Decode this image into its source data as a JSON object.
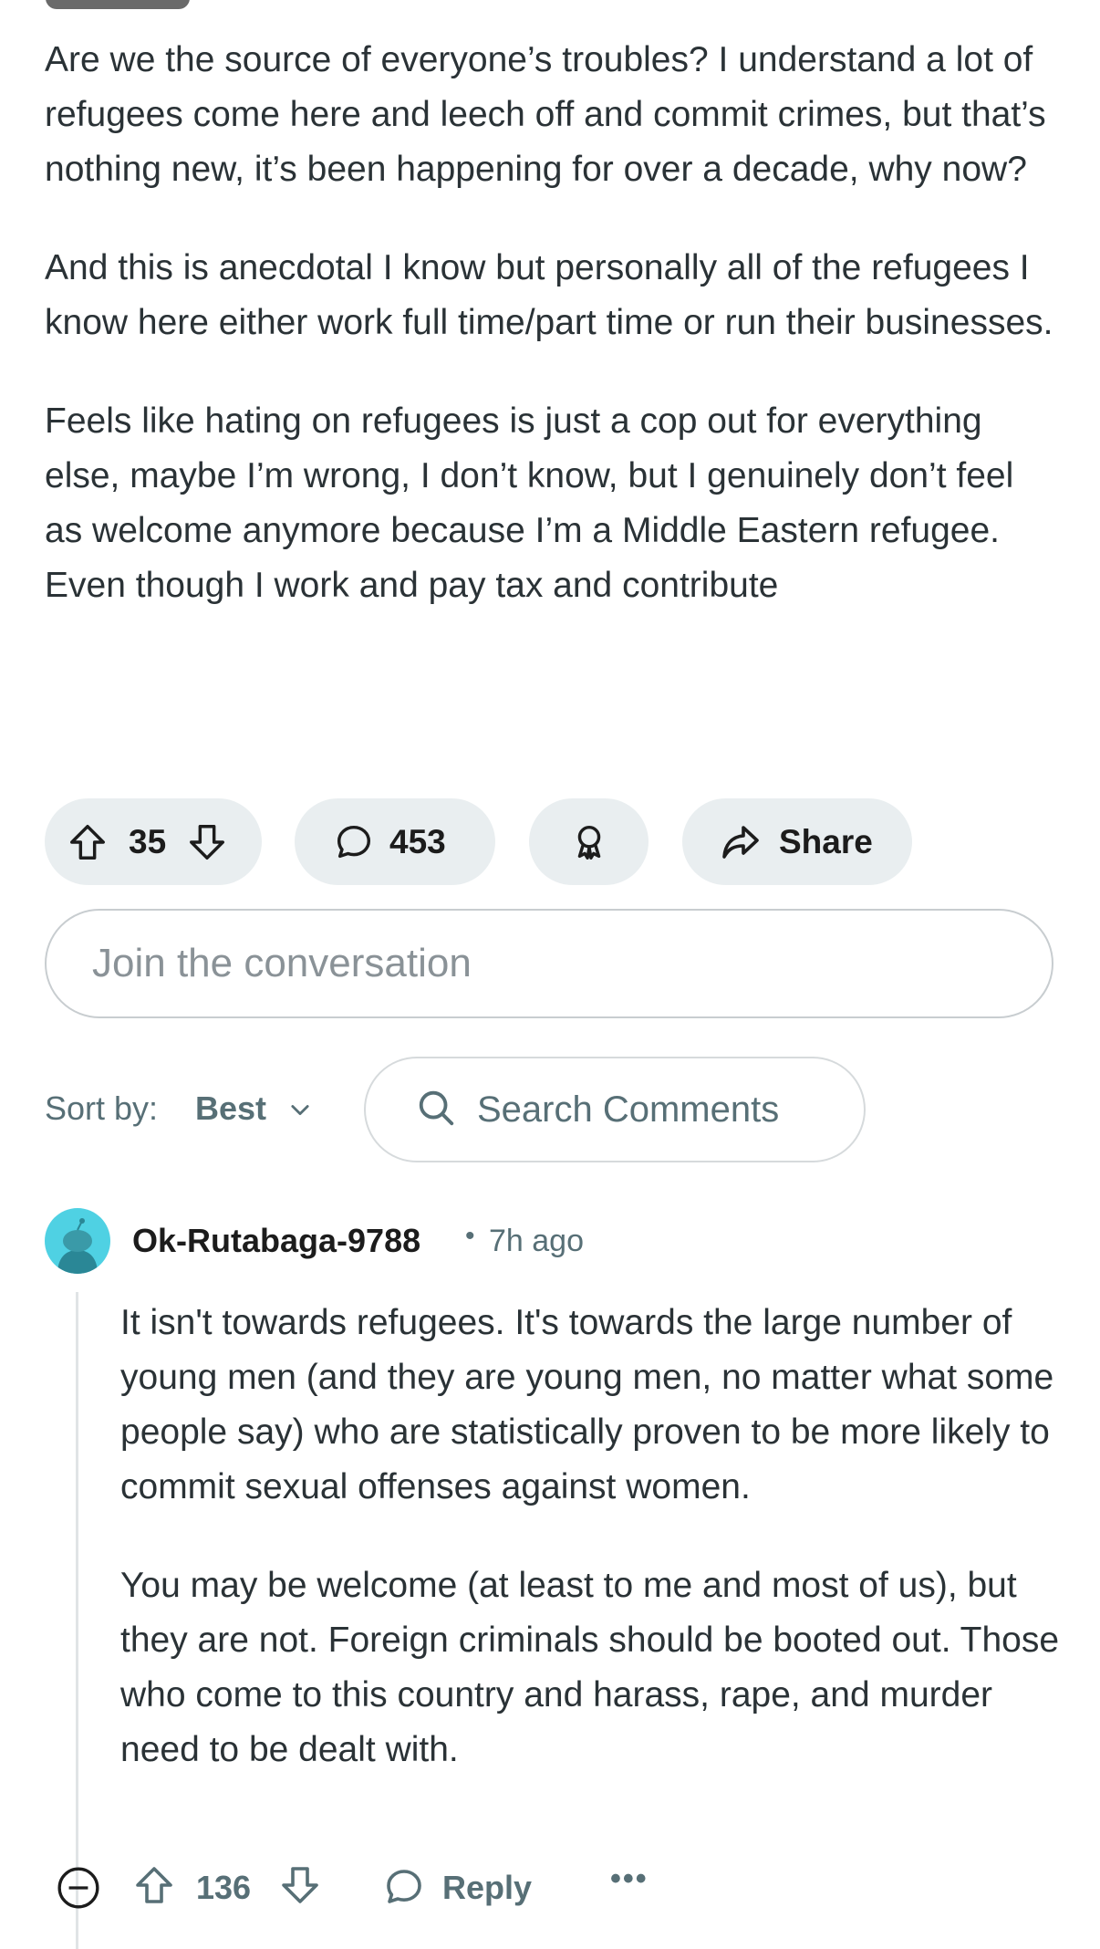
{
  "post": {
    "paragraphs": [
      "Are we the source of everyone’s troubles? I understand a lot of refugees come here and leech off and commit crimes, but that’s nothing new, it’s been happening for over a decade, why now?",
      "And this is anecdotal I know but personally all of the refugees I know here either work full time/part time or run their businesses.",
      "Feels like hating on refugees is just a cop out for everything else, maybe I’m wrong, I don’t know, but I genuinely don’t feel as welcome anymore because I’m a Middle Eastern refugee. Even though I work and pay tax and contribute"
    ],
    "votes": "35",
    "comments_count": "453",
    "share_label": "Share"
  },
  "composer": {
    "placeholder": "Join the conversation"
  },
  "sort": {
    "label": "Sort by:",
    "value": "Best",
    "search_placeholder": "Search Comments"
  },
  "comment": {
    "author": "Ok-Rutabaga-9788",
    "separator": "•",
    "time": "7h ago",
    "paragraphs": [
      "It isn't towards refugees. It's towards the large number of young men (and they are young men, no matter what some people say) who are statistically proven to be more likely to commit sexual offenses against women.",
      "You may be welcome (at least to me and most of us), but they are not. Foreign criminals should be booted out. Those who come to this country and harass, rape, and murder need to be dealt with."
    ],
    "votes": "136",
    "reply_label": "Reply",
    "more_label": "•••"
  },
  "colors": {
    "pill_bg": "#e9eef0",
    "muted_text": "#576f76",
    "avatar_bg": "#4fd1e3"
  }
}
